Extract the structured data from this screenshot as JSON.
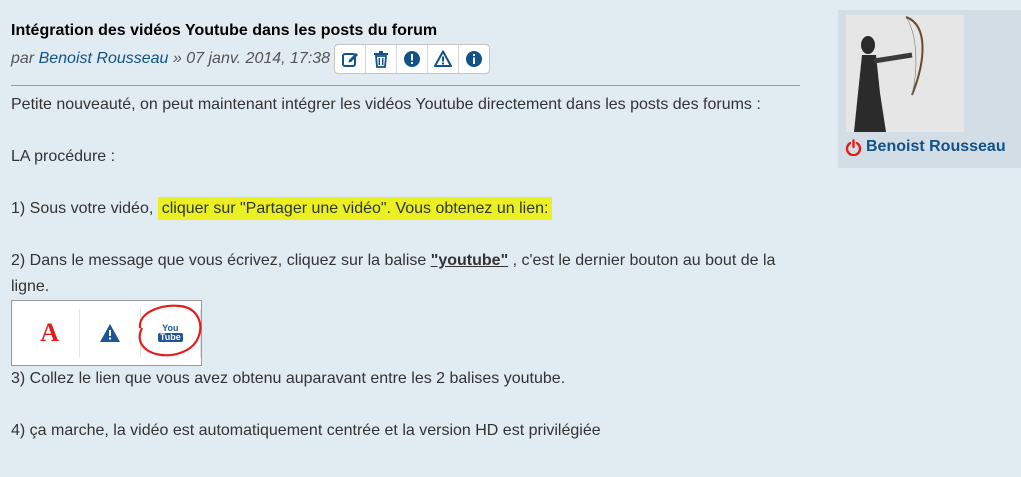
{
  "post": {
    "title": "Intégration des vidéos Youtube dans les posts du forum",
    "byline_prefix": "par",
    "author": "Benoist Rousseau",
    "byline_separator": "»",
    "date": "07 janv. 2014, 17:38",
    "actions": [
      {
        "name": "edit-icon"
      },
      {
        "name": "delete-icon"
      },
      {
        "name": "warn-icon"
      },
      {
        "name": "report-icon"
      },
      {
        "name": "info-icon"
      }
    ]
  },
  "content": {
    "intro": "Petite nouveauté, on peut maintenant intégrer les vidéos Youtube directement dans les posts des forums :",
    "procedure_heading": "LA procédure :",
    "step1_prefix": "1) Sous votre vidéo,",
    "step1_highlight": "cliquer sur \"Partager une vidéo\". Vous obtenez un lien:",
    "step2_prefix": "2) Dans le message que vous écrivez, cliquez sur la balise",
    "step2_tag": "\"youtube\"",
    "step2_suffix": ", c'est le dernier bouton au bout de la ligne.",
    "step3": "3) Collez le lien que vous avez obtenu auparavant entre les 2 balises youtube.",
    "step4": "4) ça marche, la vidéo est automatiquement centrée et la version HD est privilégiée",
    "toolbar_image": {
      "font_letter": "A",
      "youtube_top": "You",
      "youtube_bottom": "Tube"
    }
  },
  "profile": {
    "name": "Benoist Rousseau",
    "status_icon": "power-icon",
    "status_color": "#e51c1c"
  },
  "colors": {
    "background": "#e1ebf2",
    "link": "#105289",
    "highlight": "#eaf021"
  }
}
